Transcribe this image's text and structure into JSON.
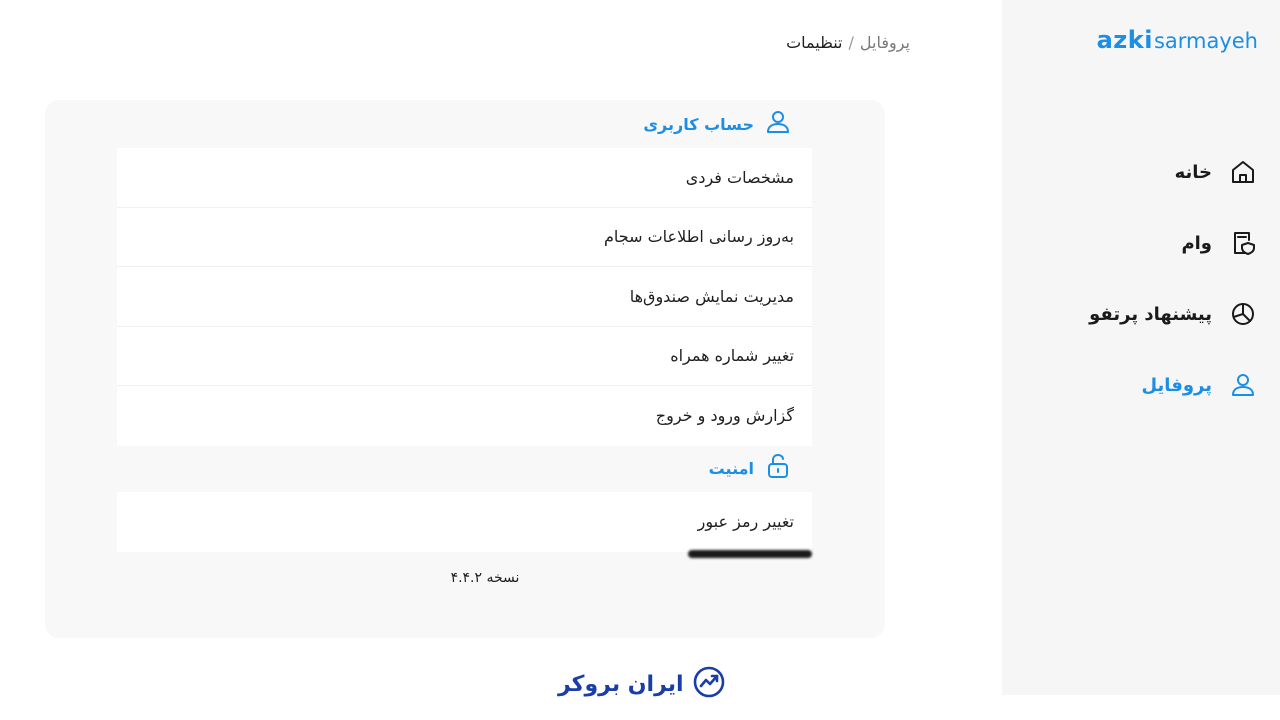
{
  "logo": {
    "part1": "azki",
    "part2": "sarmayeh"
  },
  "sidebar": {
    "items": [
      {
        "label": "خانه",
        "icon": "home-icon",
        "active": false
      },
      {
        "label": "وام",
        "icon": "loan-icon",
        "active": false
      },
      {
        "label": "پیشنهاد پرتفو",
        "icon": "pie-chart-icon",
        "active": false
      },
      {
        "label": "پروفایل",
        "icon": "user-icon",
        "active": true
      }
    ]
  },
  "breadcrumb": {
    "parent": "پروفایل",
    "separator": "/",
    "current": "تنظیمات"
  },
  "account": {
    "title": "حساب کاربری",
    "items": [
      "مشخصات فردی",
      "به‌روز رسانی اطلاعات سجام",
      "مدیریت نمایش صندوق‌ها",
      "تغییر شماره همراه",
      "گزارش ورود و خروج"
    ]
  },
  "security": {
    "title": "امنیت",
    "items": [
      "تغییر رمز عبور"
    ]
  },
  "version": "نسخه ۴.۴.۲",
  "footer": {
    "brand": "ایران بروکر"
  },
  "colors": {
    "accent": "#1b8ee8",
    "card_bg": "#f8f8f8",
    "sidebar_bg": "#f6f6f6",
    "brand_blue": "#1a3ea8"
  }
}
